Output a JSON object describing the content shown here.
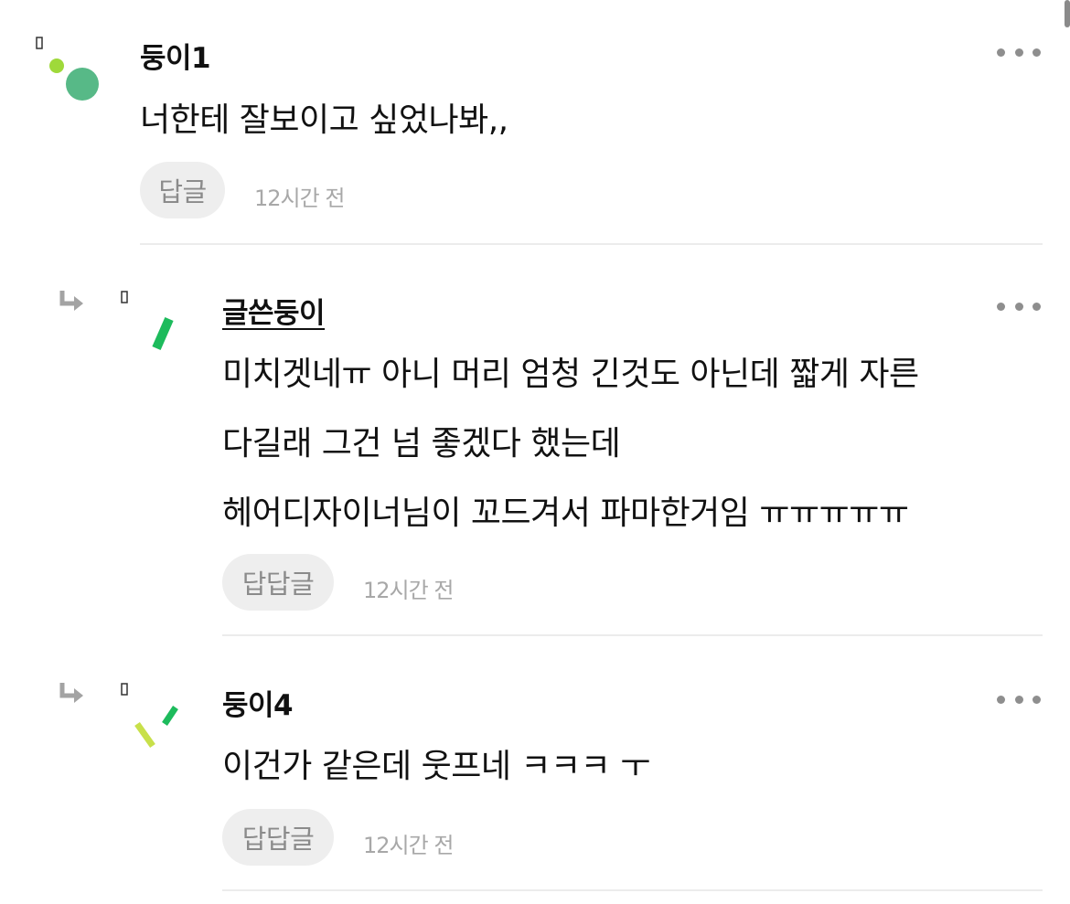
{
  "comments": [
    {
      "author": "둥이1",
      "lines": [
        "너한테 잘보이고 싶었나봐,,"
      ],
      "reply_label": "답글",
      "time": "12시간 전",
      "is_reply": false
    },
    {
      "author": "글쓴둥이",
      "lines": [
        "미치겟네ㅠ 아니 머리 엄청 긴것도 아닌데 짧게 자른",
        "다길래 그건 넘 좋겠다 했는데",
        "헤어디자이너님이 꼬드겨서 파마한거임 ㅠㅠㅠㅠㅠ"
      ],
      "reply_label": "답답글",
      "time": "12시간 전",
      "is_reply": true
    },
    {
      "author": "둥이4",
      "lines": [
        "이건가 같은데 웃프네 ㅋㅋㅋ ㅜ"
      ],
      "reply_label": "답답글",
      "time": "12시간 전",
      "is_reply": true
    }
  ],
  "icons": {
    "more": "more-dots-icon",
    "reply_arrow": "reply-arrow-icon"
  },
  "colors": {
    "avatar_green": "#57b987",
    "avatar_lime": "#9fd93a",
    "avatar_bar": "#1dbb5c",
    "avatar_yellow_green": "#c8e04a",
    "reply_bg": "#eeeeee",
    "time_text": "#a8a8a8",
    "divider": "#ececec"
  }
}
